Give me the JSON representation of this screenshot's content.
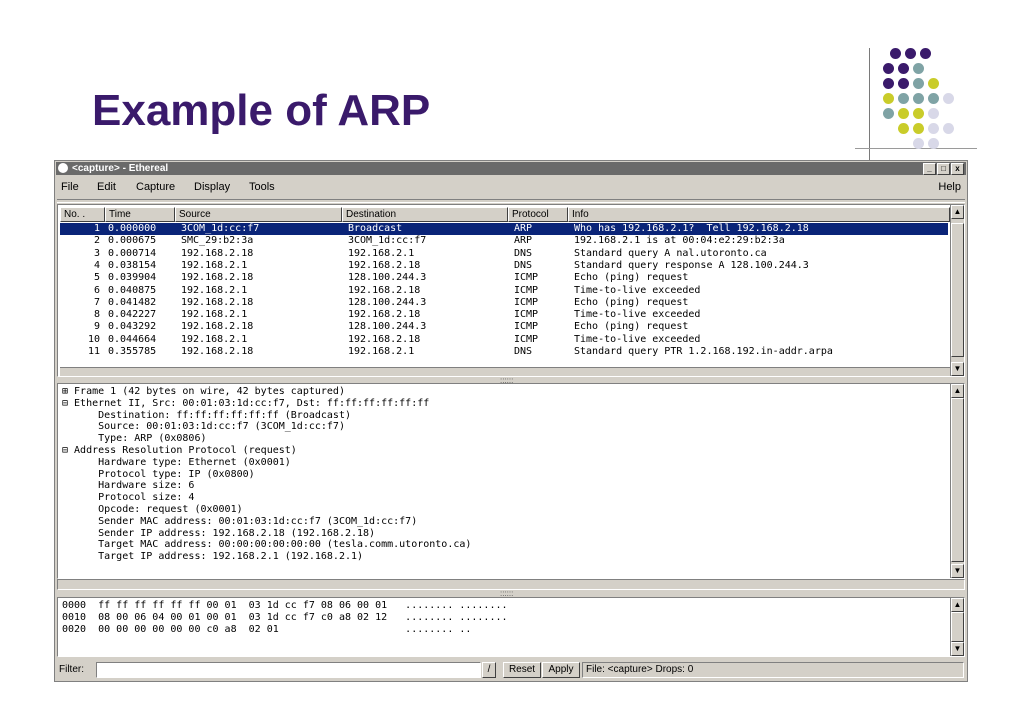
{
  "slide": {
    "title": "Example of ARP",
    "dots": [
      {
        "color": "#3a1a6b"
      },
      {
        "color": "#3a1a6b"
      },
      {
        "color": "#3a1a6b"
      },
      {
        "color": "#3a1a6b"
      },
      {
        "color": "#3a1a6b"
      },
      {
        "color": "#7fa3a5"
      },
      {
        "color": "#3a1a6b"
      },
      {
        "color": "#3a1a6b"
      },
      {
        "color": "#7fa3a5"
      },
      {
        "color": "#c9cc2a"
      },
      {
        "color": "#c9cc2a"
      },
      {
        "color": "#7fa3a5"
      },
      {
        "color": "#7fa3a5"
      },
      {
        "color": "#7fa3a5"
      },
      {
        "color": "#d8d8e8"
      },
      {
        "color": "#7fa3a5"
      },
      {
        "color": "#c9cc2a"
      },
      {
        "color": "#c9cc2a"
      },
      {
        "color": "#d8d8e8"
      },
      {
        "color": "#c9cc2a"
      },
      {
        "color": "#c9cc2a"
      },
      {
        "color": "#d8d8e8"
      },
      {
        "color": "#d8d8e8"
      },
      {
        "color": "#d8d8e8"
      },
      {
        "color": "#d8d8e8"
      }
    ]
  },
  "window": {
    "title": "<capture> - Ethereal",
    "controls": {
      "minimize": "_",
      "maximize": "□",
      "close": "x"
    },
    "menu": {
      "file": "File",
      "edit": "Edit",
      "capture": "Capture",
      "display": "Display",
      "tools": "Tools",
      "help": "Help"
    },
    "packet_list": {
      "columns": [
        "No. .",
        "Time",
        "Source",
        "Destination",
        "Protocol",
        "Info"
      ],
      "rows": [
        {
          "no": "1",
          "time": "0.000000",
          "src": "3COM_1d:cc:f7",
          "dst": "Broadcast",
          "proto": "ARP",
          "info": "Who has 192.168.2.1?  Tell 192.168.2.18",
          "selected": true
        },
        {
          "no": "2",
          "time": "0.000675",
          "src": "SMC_29:b2:3a",
          "dst": "3COM_1d:cc:f7",
          "proto": "ARP",
          "info": "192.168.2.1 is at 00:04:e2:29:b2:3a"
        },
        {
          "no": "3",
          "time": "0.000714",
          "src": "192.168.2.18",
          "dst": "192.168.2.1",
          "proto": "DNS",
          "info": "Standard query A nal.utoronto.ca"
        },
        {
          "no": "4",
          "time": "0.038154",
          "src": "192.168.2.1",
          "dst": "192.168.2.18",
          "proto": "DNS",
          "info": "Standard query response A 128.100.244.3"
        },
        {
          "no": "5",
          "time": "0.039904",
          "src": "192.168.2.18",
          "dst": "128.100.244.3",
          "proto": "ICMP",
          "info": "Echo (ping) request"
        },
        {
          "no": "6",
          "time": "0.040875",
          "src": "192.168.2.1",
          "dst": "192.168.2.18",
          "proto": "ICMP",
          "info": "Time-to-live exceeded"
        },
        {
          "no": "7",
          "time": "0.041482",
          "src": "192.168.2.18",
          "dst": "128.100.244.3",
          "proto": "ICMP",
          "info": "Echo (ping) request"
        },
        {
          "no": "8",
          "time": "0.042227",
          "src": "192.168.2.1",
          "dst": "192.168.2.18",
          "proto": "ICMP",
          "info": "Time-to-live exceeded"
        },
        {
          "no": "9",
          "time": "0.043292",
          "src": "192.168.2.18",
          "dst": "128.100.244.3",
          "proto": "ICMP",
          "info": "Echo (ping) request"
        },
        {
          "no": "10",
          "time": "0.044664",
          "src": "192.168.2.1",
          "dst": "192.168.2.18",
          "proto": "ICMP",
          "info": "Time-to-live exceeded"
        },
        {
          "no": "11",
          "time": "0.355785",
          "src": "192.168.2.18",
          "dst": "192.168.2.1",
          "proto": "DNS",
          "info": "Standard query PTR 1.2.168.192.in-addr.arpa"
        }
      ]
    },
    "details": [
      "⊞ Frame 1 (42 bytes on wire, 42 bytes captured)",
      "⊟ Ethernet II, Src: 00:01:03:1d:cc:f7, Dst: ff:ff:ff:ff:ff:ff",
      "      Destination: ff:ff:ff:ff:ff:ff (Broadcast)",
      "      Source: 00:01:03:1d:cc:f7 (3COM_1d:cc:f7)",
      "      Type: ARP (0x0806)",
      "⊟ Address Resolution Protocol (request)",
      "      Hardware type: Ethernet (0x0001)",
      "      Protocol type: IP (0x0800)",
      "      Hardware size: 6",
      "      Protocol size: 4",
      "      Opcode: request (0x0001)",
      "      Sender MAC address: 00:01:03:1d:cc:f7 (3COM_1d:cc:f7)",
      "      Sender IP address: 192.168.2.18 (192.168.2.18)",
      "      Target MAC address: 00:00:00:00:00:00 (tesla.comm.utoronto.ca)",
      "      Target IP address: 192.168.2.1 (192.168.2.1)"
    ],
    "hex": [
      "0000  ff ff ff ff ff ff 00 01  03 1d cc f7 08 06 00 01   ........ ........",
      "0010  08 00 06 04 00 01 00 01  03 1d cc f7 c0 a8 02 12   ........ ........",
      "0020  00 00 00 00 00 00 c0 a8  02 01                     ........ .."
    ],
    "status": {
      "filter_label": "Filter:",
      "filter_value": "",
      "reset": "Reset",
      "apply": "Apply",
      "info": "File: <capture>  Drops: 0"
    }
  }
}
